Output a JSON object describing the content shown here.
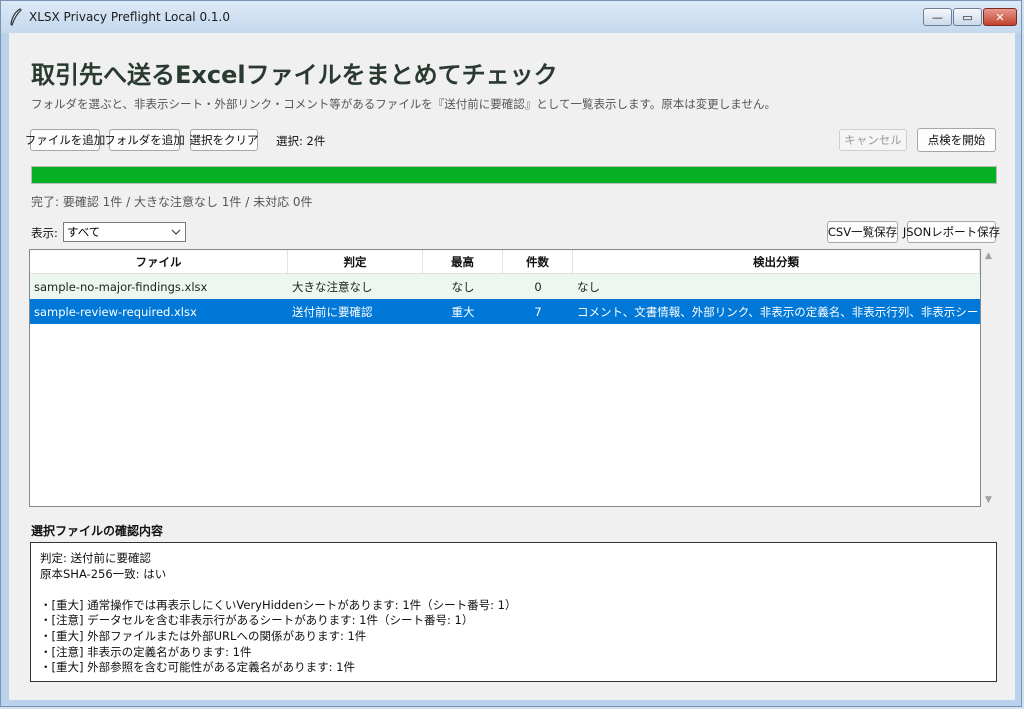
{
  "window": {
    "title": "XLSX Privacy Preflight Local 0.1.0",
    "controls": {
      "minimize": "—",
      "maximize": "▭",
      "close": "✕"
    }
  },
  "header": {
    "title": "取引先へ送るExcelファイルをまとめてチェック",
    "subtitle": "フォルダを選ぶと、非表示シート・外部リンク・コメント等があるファイルを『送付前に要確認』として一覧表示します。原本は変更しません。"
  },
  "toolbar": {
    "add_files": "ファイルを追加",
    "add_folder": "フォルダを追加",
    "clear_selection": "選択をクリア",
    "selection_count": "選択: 2件",
    "cancel": "キャンセル",
    "start_check": "点検を開始"
  },
  "progress": {
    "value": 1.0,
    "color": "#06b025"
  },
  "status": "完了: 要確認 1件 / 大きな注意なし 1件 / 未対応 0件",
  "filter": {
    "label": "表示:",
    "selected": "すべて",
    "csv_save": "CSV一覧保存",
    "json_save": "JSONレポート保存"
  },
  "table": {
    "columns": [
      "ファイル",
      "判定",
      "最高",
      "件数",
      "検出分類"
    ],
    "rows": [
      {
        "file": "sample-no-major-findings.xlsx",
        "verdict": "大きな注意なし",
        "severity": "なし",
        "count": "0",
        "categories": "なし"
      },
      {
        "file": "sample-review-required.xlsx",
        "verdict": "送付前に要確認",
        "severity": "重大",
        "count": "7",
        "categories": "コメント、文書情報、外部リンク、非表示の定義名、非表示行列、非表示シート"
      }
    ]
  },
  "detail": {
    "label": "選択ファイルの確認内容",
    "lines": [
      "判定: 送付前に要確認",
      "原本SHA-256一致: はい",
      "",
      "・[重大] 通常操作では再表示しにくいVeryHiddenシートがあります: 1件（シート番号: 1）",
      "・[注意] データセルを含む非表示行があるシートがあります: 1件（シート番号: 1）",
      "・[重大] 外部ファイルまたは外部URLへの関係があります: 1件",
      "・[注意] 非表示の定義名があります: 1件",
      "・[重大] 外部参照を含む可能性がある定義名があります: 1件"
    ]
  }
}
